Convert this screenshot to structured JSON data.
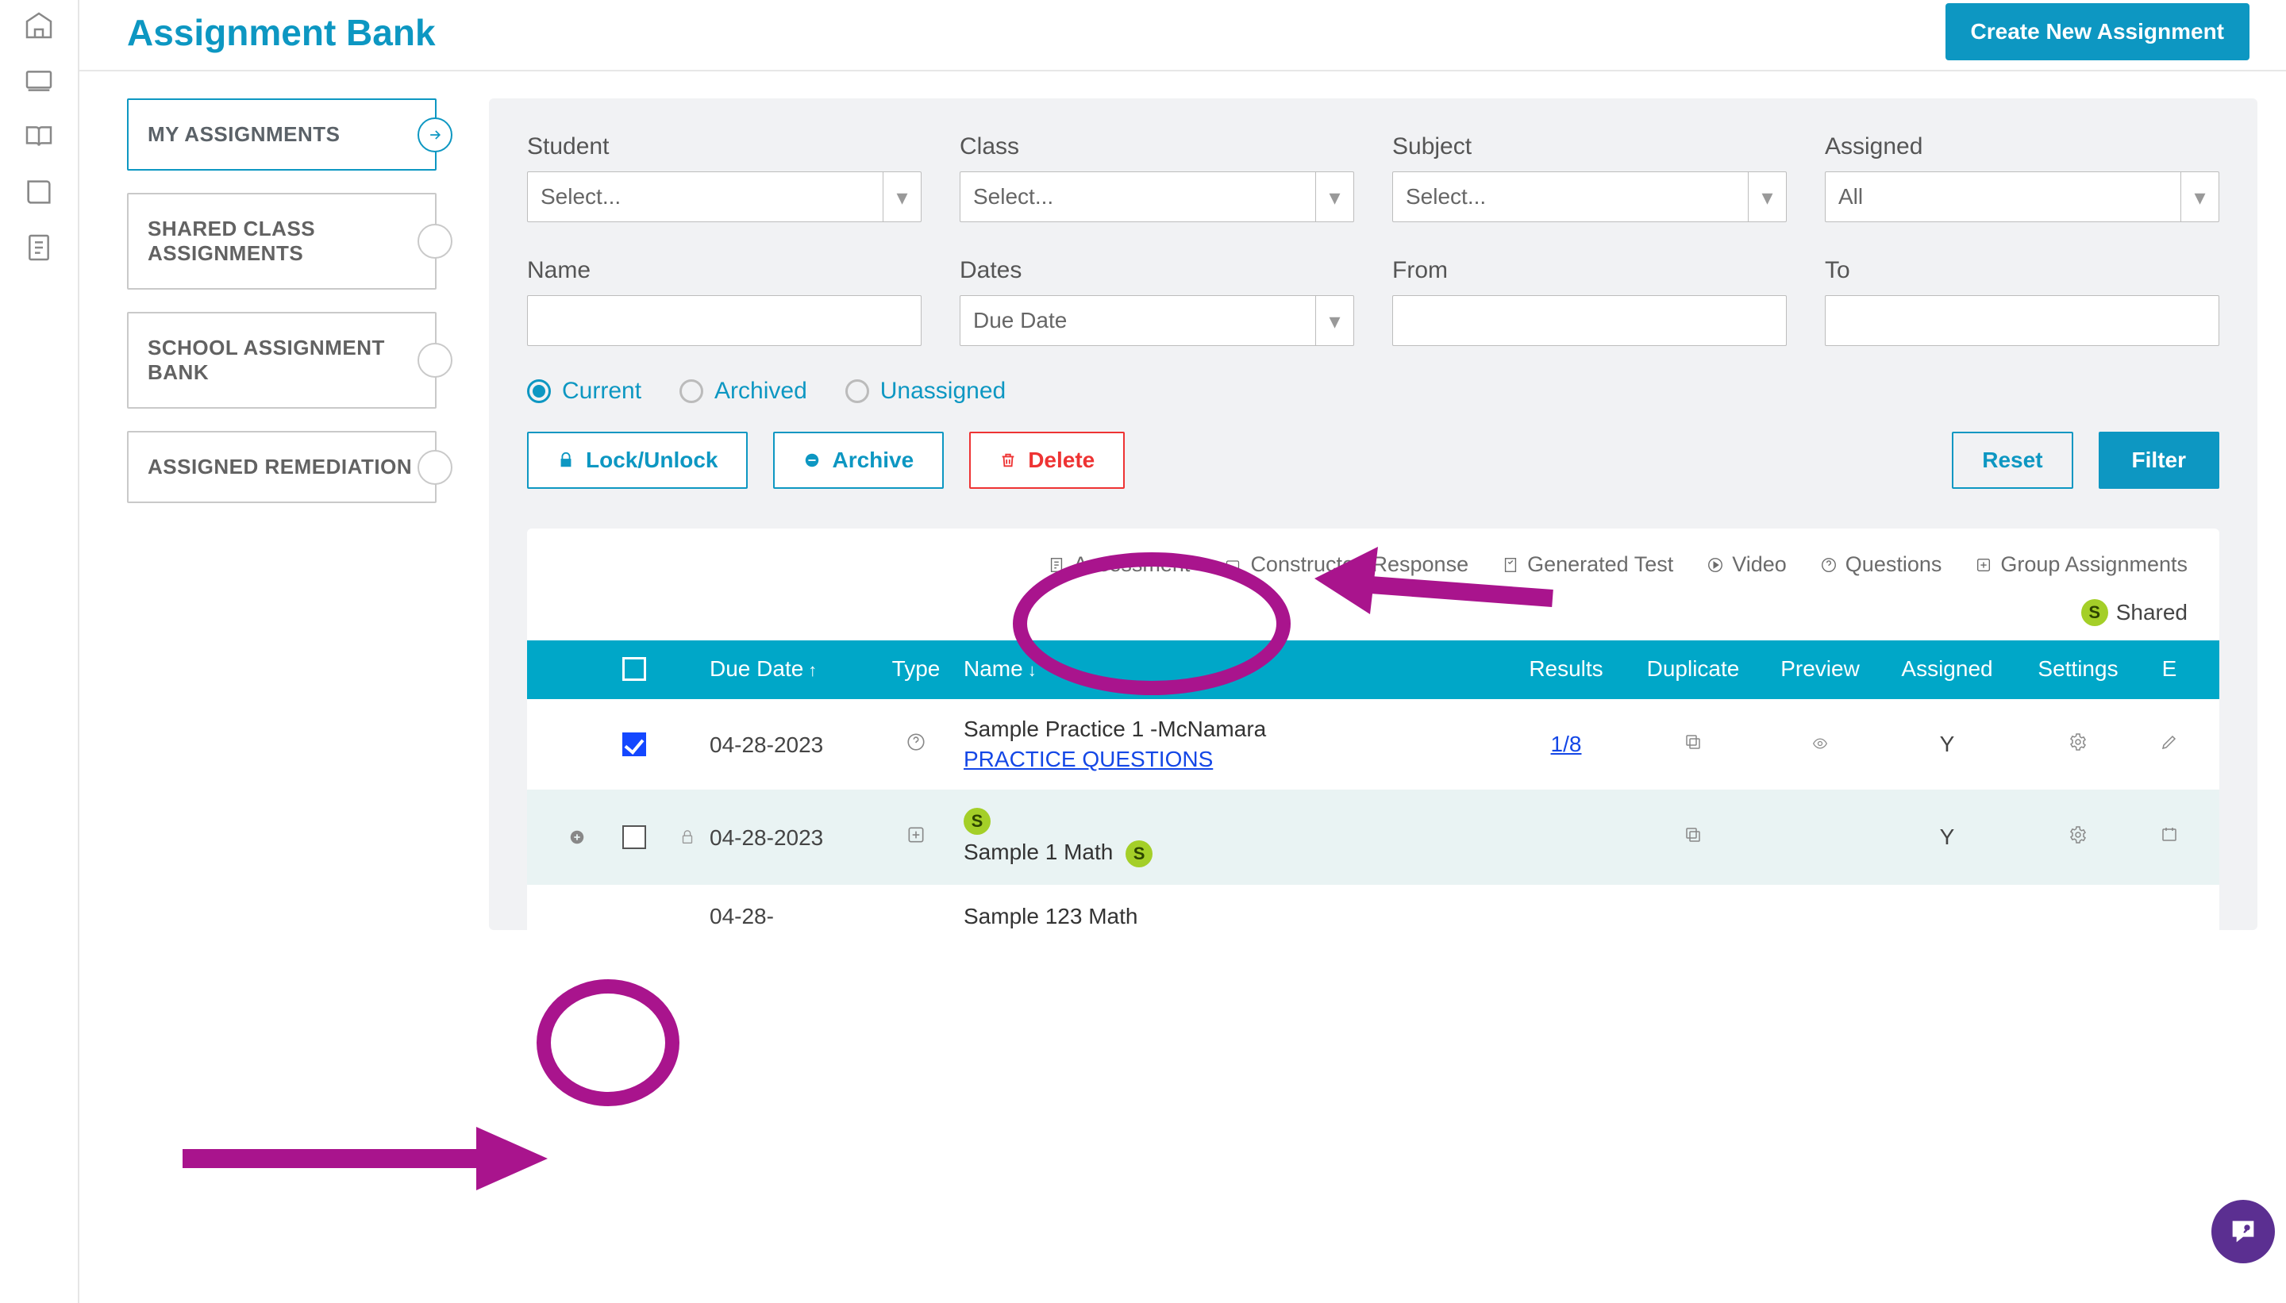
{
  "page_title": "Assignment Bank",
  "sidebar": {
    "items": [
      {
        "label": "MY ASSIGNMENTS",
        "active": true
      },
      {
        "label": "SHARED CLASS ASSIGNMENTS",
        "active": false
      },
      {
        "label": "SCHOOL ASSIGNMENT BANK",
        "active": false
      },
      {
        "label": "ASSIGNED REMEDIATION",
        "active": false
      }
    ]
  },
  "create_button": "Create New Assignment",
  "filters": {
    "student": {
      "label": "Student",
      "placeholder": "Select..."
    },
    "class": {
      "label": "Class",
      "placeholder": "Select..."
    },
    "subject": {
      "label": "Subject",
      "placeholder": "Select..."
    },
    "assigned": {
      "label": "Assigned",
      "value": "All"
    },
    "name": {
      "label": "Name",
      "value": ""
    },
    "dates": {
      "label": "Dates",
      "value": "Due Date"
    },
    "from": {
      "label": "From",
      "value": ""
    },
    "to": {
      "label": "To",
      "value": ""
    }
  },
  "status_radios": {
    "current": "Current",
    "archived": "Archived",
    "unassigned": "Unassigned",
    "selected": "current"
  },
  "actions": {
    "lock": "Lock/Unlock",
    "archive": "Archive",
    "delete": "Delete",
    "reset": "Reset",
    "filter": "Filter"
  },
  "legend": {
    "assessment": "Assessment",
    "constructed": "Constructed Response",
    "generated": "Generated Test",
    "video": "Video",
    "questions": "Questions",
    "group": "Group Assignments",
    "shared": "Shared",
    "shared_badge": "S"
  },
  "table": {
    "headers": {
      "due": "Due Date",
      "type": "Type",
      "name": "Name",
      "results": "Results",
      "duplicate": "Duplicate",
      "preview": "Preview",
      "assigned": "Assigned",
      "settings": "Settings",
      "edit": "E"
    },
    "rows": [
      {
        "checked": true,
        "due": "04-28-2023",
        "type_icon": "questions",
        "name": "Sample Practice 1 -McNamara",
        "name_sub": "PRACTICE QUESTIONS",
        "results": "1/8",
        "assigned": "Y",
        "shared": false,
        "expandable": false
      },
      {
        "checked": false,
        "due": "04-28-2023",
        "type_icon": "group",
        "name": "Sample 1 Math",
        "name_sub": "",
        "results": "",
        "assigned": "Y",
        "shared": true,
        "expandable": true
      },
      {
        "checked": false,
        "due": "04-28-",
        "type_icon": "",
        "name": "Sample 123 Math",
        "name_sub": "",
        "results": "",
        "assigned": "",
        "shared": false,
        "expandable": false
      }
    ]
  }
}
